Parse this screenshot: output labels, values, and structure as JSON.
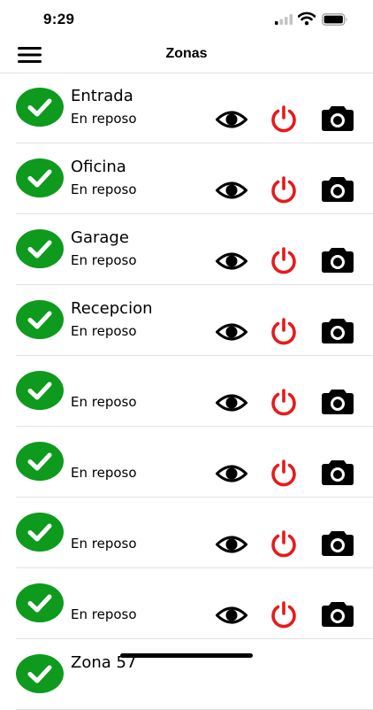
{
  "status_bar": {
    "time": "9:29"
  },
  "header": {
    "title": "Zonas"
  },
  "colors": {
    "check_green": "#0e9a1d",
    "power_red": "#e8191b",
    "icon_black": "#000000",
    "divider": "#e3e3e3"
  },
  "icons": {
    "menu": "hamburger-menu-icon",
    "status": "check-circle-icon",
    "view": "eye-icon",
    "power": "power-icon",
    "camera": "camera-icon"
  },
  "zones": [
    {
      "name": "Entrada",
      "state": "En reposo"
    },
    {
      "name": "Oficina",
      "state": "En reposo"
    },
    {
      "name": "Garage",
      "state": "En reposo"
    },
    {
      "name": "Recepcion",
      "state": "En reposo"
    },
    {
      "name": "",
      "state": "En reposo"
    },
    {
      "name": "",
      "state": "En reposo"
    },
    {
      "name": "",
      "state": "En reposo"
    },
    {
      "name": "",
      "state": "En reposo"
    },
    {
      "name": "Zona 57",
      "state": ""
    }
  ]
}
